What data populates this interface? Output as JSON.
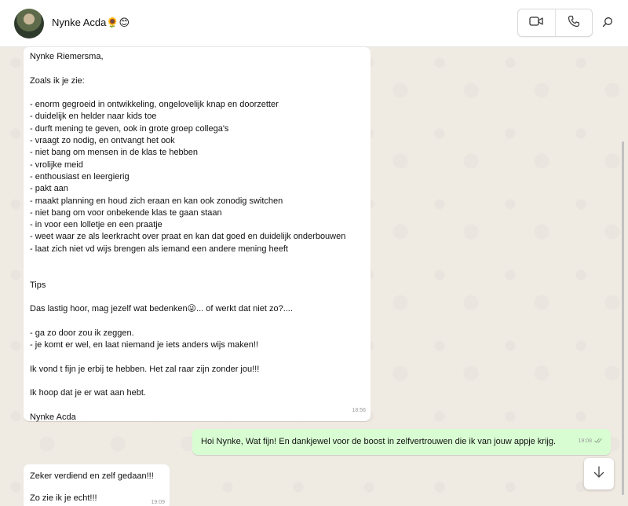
{
  "header": {
    "contact_name": "Nynke Acda🌻😊",
    "icons": [
      "video-call-icon",
      "voice-call-icon",
      "search-icon"
    ]
  },
  "messages": [
    {
      "direction": "incoming",
      "text": "Nynke Riemersma,\n\nZoals ik je zie:\n\n- enorm gegroeid in ontwikkeling, ongelovelijk knap en doorzetter\n- duidelijk en helder naar kids toe\n- durft mening te geven, ook in grote groep collega's\n- vraagt zo nodig, en ontvangt het ook\n- niet bang om mensen in de klas te hebben\n- vrolijke meid\n- enthousiast en leergierig\n- pakt aan\n- maakt planning en houd zich eraan en kan ook zonodig switchen\n- niet bang om voor onbekende klas te gaan staan\n- in voor een lolletje en een praatje\n- weet waar ze als leerkracht over praat en kan dat goed en duidelijk onderbouwen\n- laat zich niet vd wijs brengen als iemand een andere mening heeft\n\n\nTips\n\nDas lastig hoor, mag jezelf wat bedenken😜... of werkt dat niet zo?....\n\n- ga zo door zou ik zeggen.\n- je komt er wel, en laat niemand je iets anders wijs maken!!\n\nIk vond t fijn je erbij te hebben. Het zal raar zijn zonder jou!!!\n\nIk hoop dat je er wat aan hebt.\n\nNynke Acda",
      "time": "18:56"
    },
    {
      "direction": "outgoing",
      "text": "Hoi Nynke, Wat fijn! En dankjewel voor de boost in zelfvertrouwen die ik van jouw appje krijg.",
      "time": "19:08"
    },
    {
      "direction": "incoming",
      "text": "Zeker verdiend en zelf gedaan!!!\n\nZo zie ik je echt!!!",
      "time": "19:09"
    }
  ]
}
